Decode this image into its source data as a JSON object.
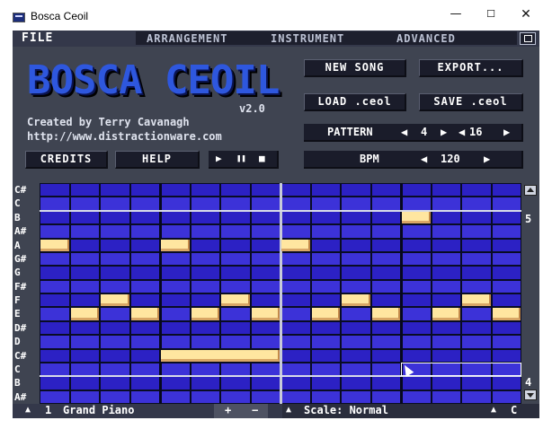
{
  "window": {
    "title": "Bosca Ceoil",
    "minimize_glyph": "—",
    "maximize_glyph": "☐",
    "close_glyph": "✕"
  },
  "menu": {
    "file": "FILE",
    "tabs": [
      "ARRANGEMENT",
      "INSTRUMENT",
      "ADVANCED"
    ]
  },
  "header": {
    "logo": "BOSCA CEOIL",
    "version": "v2.0",
    "credit_line": "Created by Terry Cavanagh",
    "url": "http://www.distractionware.com"
  },
  "buttons": {
    "credits": "CREDITS",
    "help": "HELP",
    "new_song": "NEW SONG",
    "export": "EXPORT...",
    "load": "LOAD .ceol",
    "save": "SAVE .ceol"
  },
  "transport": {
    "play": "▶",
    "pause": "❚❚",
    "stop": "■"
  },
  "pattern": {
    "label": "PATTERN",
    "number": "4",
    "length": "16"
  },
  "bpm": {
    "label": "BPM",
    "value": "120"
  },
  "piano_roll": {
    "keys": [
      "C#",
      "C",
      "B",
      "A#",
      "A",
      "G#",
      "G",
      "F#",
      "F",
      "E",
      "D#",
      "D",
      "C#",
      "C",
      "B",
      "A#"
    ],
    "octave_upper": "5",
    "octave_lower": "4",
    "columns": 16,
    "notes": [
      {
        "row": 4,
        "col": 0,
        "len": 1
      },
      {
        "row": 4,
        "col": 4,
        "len": 1
      },
      {
        "row": 4,
        "col": 8,
        "len": 1
      },
      {
        "row": 2,
        "col": 12,
        "len": 1
      },
      {
        "row": 8,
        "col": 2,
        "len": 1
      },
      {
        "row": 8,
        "col": 6,
        "len": 1
      },
      {
        "row": 8,
        "col": 10,
        "len": 1
      },
      {
        "row": 8,
        "col": 14,
        "len": 1
      },
      {
        "row": 9,
        "col": 1,
        "len": 1
      },
      {
        "row": 9,
        "col": 3,
        "len": 1
      },
      {
        "row": 9,
        "col": 5,
        "len": 1
      },
      {
        "row": 9,
        "col": 7,
        "len": 1
      },
      {
        "row": 9,
        "col": 9,
        "len": 1
      },
      {
        "row": 9,
        "col": 11,
        "len": 1
      },
      {
        "row": 9,
        "col": 13,
        "len": 1
      },
      {
        "row": 9,
        "col": 15,
        "len": 1
      },
      {
        "row": 12,
        "col": 4,
        "len": 4
      }
    ],
    "cursor": {
      "row": 13,
      "col": 12,
      "len": 4
    },
    "colors": {
      "cell_even": "#2c21c4",
      "cell_odd": "#3c32d8",
      "beat_line": "#06081c",
      "bar_line": "#c8cbd8",
      "note": "#ffe6a0"
    }
  },
  "bottom": {
    "instrument_number": "1",
    "instrument_name": "Grand Piano",
    "add": "+",
    "remove": "−",
    "scale": "Scale: Normal",
    "key": "C"
  }
}
